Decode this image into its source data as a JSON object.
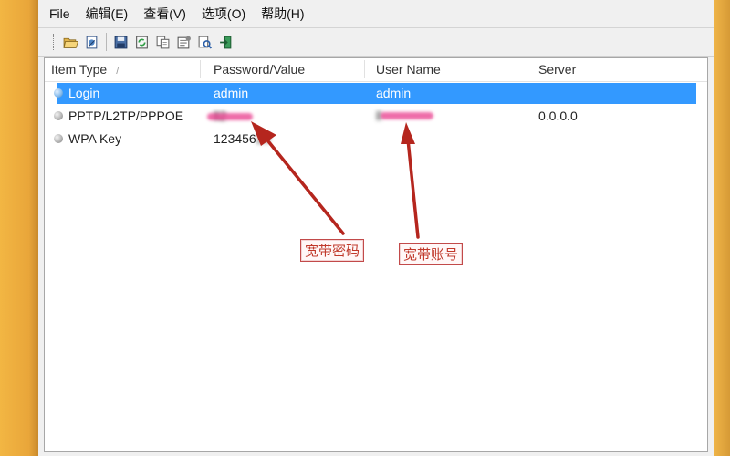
{
  "menu": [
    "File",
    "编辑(E)",
    "查看(V)",
    "选项(O)",
    "帮助(H)"
  ],
  "toolbar": {
    "icons": [
      "open-folder-icon",
      "open-file-icon",
      "save-icon",
      "refresh-icon",
      "copy-icon",
      "properties-icon",
      "find-icon",
      "exit-icon"
    ]
  },
  "table": {
    "columns": [
      "Item Type",
      "Password/Value",
      "User Name",
      "Server"
    ],
    "sort_indicator": "/",
    "rows": [
      {
        "type": "Login",
        "value": "admin",
        "user": "admin",
        "server": "",
        "selected": true
      },
      {
        "type": "PPTP/L2TP/PPPOE",
        "value": "ll2",
        "user": "ll",
        "server": "0.0.0.0",
        "selected": false
      },
      {
        "type": "WPA Key",
        "value": "123456",
        "value_tail": "29",
        "user": "",
        "server": "",
        "selected": false
      }
    ]
  },
  "annotations": {
    "password_label": "宽带密码",
    "account_label": "宽带账号",
    "arrow_color": "#c0392b"
  },
  "colors": {
    "selection": "#3399ff",
    "frame": "#f0b548",
    "redaction": "#e83c8c"
  }
}
